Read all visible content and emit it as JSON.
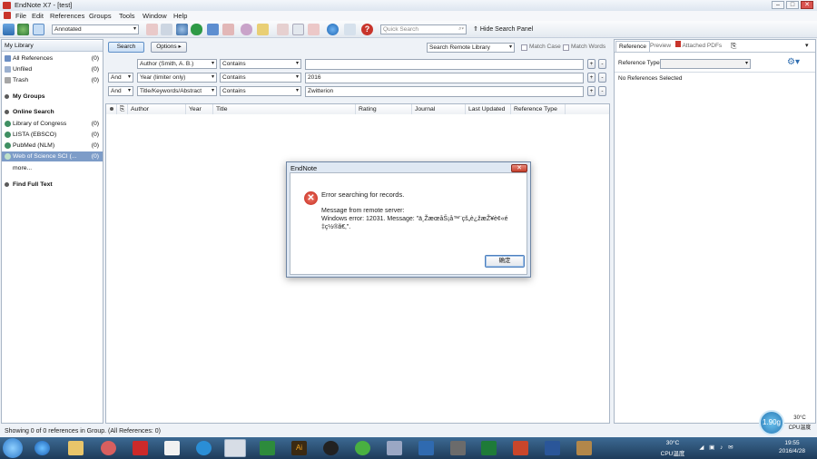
{
  "window": {
    "title": "EndNote X7 - [test]",
    "minimize": "–",
    "maximize": "□",
    "close": "✕"
  },
  "menu": [
    "File",
    "Edit",
    "References",
    "Groups",
    "Tools",
    "Window",
    "Help"
  ],
  "toolbar": {
    "style_value": "Annotated",
    "quick_search_placeholder": "Quick Search",
    "hide_panel_label": "Hide Search Panel"
  },
  "sidebar": {
    "header": "My Library",
    "library_items": [
      {
        "label": "All References",
        "count": "(0)"
      },
      {
        "label": "Unfiled",
        "count": "(0)"
      },
      {
        "label": "Trash",
        "count": "(0)"
      }
    ],
    "my_groups": "My Groups",
    "online_search": "Online Search",
    "online_items": [
      {
        "label": "Library of Congress",
        "count": "(0)"
      },
      {
        "label": "LISTA (EBSCO)",
        "count": "(0)"
      },
      {
        "label": "PubMed (NLM)",
        "count": "(0)"
      },
      {
        "label": "Web of Science SCI (...",
        "count": "(0)"
      }
    ],
    "more": "more...",
    "find_full_text": "Find Full Text"
  },
  "search_panel": {
    "search_button": "Search",
    "options_button": "Options ▸",
    "search_remote": "Search Remote Library",
    "match_case": "Match Case",
    "match_words": "Match Words",
    "rows": [
      {
        "bool": "",
        "field": "Author (Smith, A. B.)",
        "op": "Contains",
        "value": ""
      },
      {
        "bool": "And",
        "field": "Year (limiter only)",
        "op": "Contains",
        "value": "2016"
      },
      {
        "bool": "And",
        "field": "Title/Keywords/Abstract",
        "op": "Contains",
        "value": "Zwitterion"
      }
    ]
  },
  "results": {
    "columns": [
      "Author",
      "Year",
      "Title",
      "Rating",
      "Journal",
      "Last Updated",
      "Reference Type"
    ]
  },
  "right_panel": {
    "tabs": [
      "Reference",
      "Preview",
      "Attached PDFs"
    ],
    "reference_type_label": "Reference Type:",
    "no_selection": "No References Selected"
  },
  "status": "Showing 0 of 0 references in Group. (All References: 0)",
  "dialog": {
    "title": "EndNote",
    "line1": "Error searching for records.",
    "line2": "Message from remote server:",
    "line3": "Windows error: 12031. Message: \"ä¸ŽæœåŠ¡å™¨çš„è¿žæŽ¥è¢«é",
    "line4": "‡ç½®ã€‚\".",
    "ok_button": "确定",
    "close": "✕"
  },
  "taskbar": {
    "temp": "30°C",
    "cpu": "CPU温度",
    "time": "19:55",
    "date": "2016/4/28",
    "gadget_value": "1.90g",
    "gadget_temp": "30°C",
    "gadget_cpu": "CPU温度"
  },
  "colors": {
    "accent": "#3b78c4",
    "error": "#c8342b",
    "selected": "#7d9cc8"
  }
}
